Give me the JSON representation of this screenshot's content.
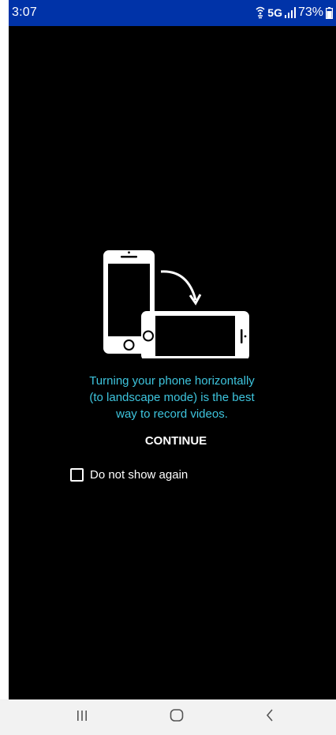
{
  "status_bar": {
    "time": "3:07",
    "network": "5G",
    "battery": "73%",
    "background_color": "#0033a8"
  },
  "dialog": {
    "message_line1": "Turning your phone horizontally",
    "message_line2": "(to landscape mode) is the best",
    "message_line3": "way to record videos.",
    "continue_label": "CONTINUE",
    "checkbox_label": "Do not show again",
    "checkbox_checked": false,
    "message_color": "#3ec5de",
    "illustration_icon": "rotate-phone-icon"
  },
  "nav_bar": {
    "recents_icon": "recent-apps-icon",
    "home_icon": "home-icon",
    "back_icon": "back-icon"
  }
}
